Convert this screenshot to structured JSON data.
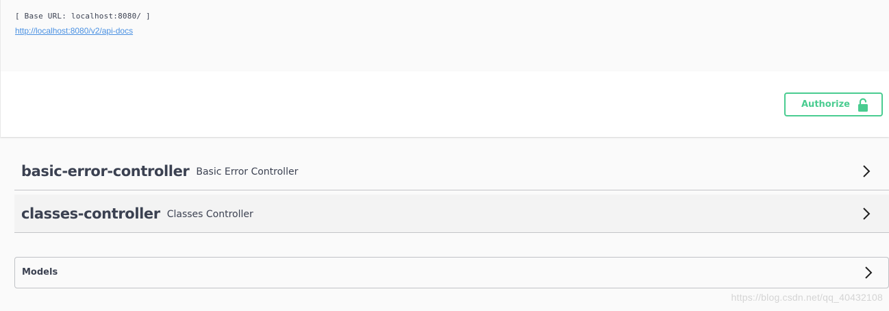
{
  "info": {
    "base_url": "[ Base URL: localhost:8080/ ]",
    "docs_link": "http://localhost:8080/v2/api-docs"
  },
  "auth": {
    "authorize_label": "Authorize",
    "icon": "unlocked-padlock-icon",
    "color": "#49cc90"
  },
  "tags": [
    {
      "name": "basic-error-controller",
      "description": "Basic Error Controller"
    },
    {
      "name": "classes-controller",
      "description": "Classes Controller"
    }
  ],
  "models": {
    "title": "Models"
  },
  "watermark": "https://blog.csdn.net/qq_40432108"
}
